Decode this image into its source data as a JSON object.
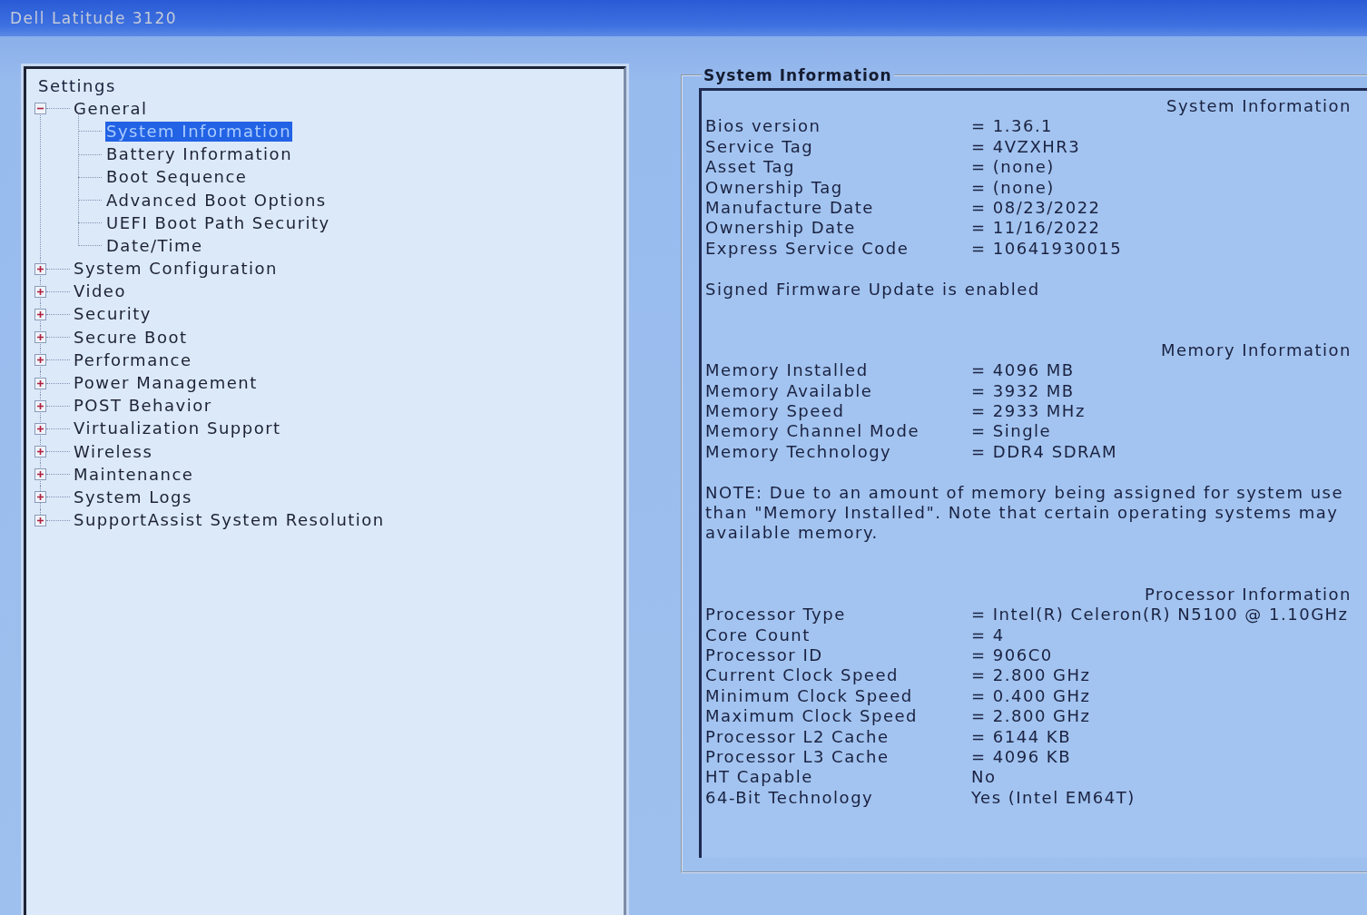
{
  "window": {
    "title": "Dell Latitude 3120"
  },
  "tree": {
    "title": "Settings",
    "items": [
      {
        "label": "General",
        "expanded": true,
        "selected": false,
        "children": [
          {
            "label": "System Information",
            "selected": true
          },
          {
            "label": "Battery Information",
            "selected": false
          },
          {
            "label": "Boot Sequence",
            "selected": false
          },
          {
            "label": "Advanced Boot Options",
            "selected": false
          },
          {
            "label": "UEFI Boot Path Security",
            "selected": false
          },
          {
            "label": "Date/Time",
            "selected": false
          }
        ]
      },
      {
        "label": "System Configuration",
        "expanded": false,
        "selected": false
      },
      {
        "label": "Video",
        "expanded": false,
        "selected": false
      },
      {
        "label": "Security",
        "expanded": false,
        "selected": false
      },
      {
        "label": "Secure Boot",
        "expanded": false,
        "selected": false
      },
      {
        "label": "Performance",
        "expanded": false,
        "selected": false
      },
      {
        "label": "Power Management",
        "expanded": false,
        "selected": false
      },
      {
        "label": "POST Behavior",
        "expanded": false,
        "selected": false
      },
      {
        "label": "Virtualization Support",
        "expanded": false,
        "selected": false
      },
      {
        "label": "Wireless",
        "expanded": false,
        "selected": false
      },
      {
        "label": "Maintenance",
        "expanded": false,
        "selected": false
      },
      {
        "label": "System Logs",
        "expanded": false,
        "selected": false
      },
      {
        "label": "SupportAssist System Resolution",
        "expanded": false,
        "selected": false
      }
    ]
  },
  "panel": {
    "title": "System Information",
    "sections": [
      {
        "heading": "System Information",
        "rows": [
          {
            "label": "Bios version",
            "value": "= 1.36.1"
          },
          {
            "label": "Service Tag",
            "value": "= 4VZXHR3"
          },
          {
            "label": "Asset Tag",
            "value": "= (none)"
          },
          {
            "label": "Ownership Tag",
            "value": "= (none)"
          },
          {
            "label": "Manufacture Date",
            "value": "= 08/23/2022"
          },
          {
            "label": "Ownership Date",
            "value": "= 11/16/2022"
          },
          {
            "label": "Express Service Code",
            "value": "= 10641930015"
          }
        ],
        "note_lines": [
          "Signed Firmware Update is enabled"
        ]
      },
      {
        "heading": "Memory Information",
        "rows": [
          {
            "label": "Memory Installed",
            "value": "= 4096 MB"
          },
          {
            "label": "Memory Available",
            "value": "= 3932 MB"
          },
          {
            "label": "Memory Speed",
            "value": "= 2933 MHz"
          },
          {
            "label": "Memory Channel Mode",
            "value": "= Single"
          },
          {
            "label": "Memory Technology",
            "value": "= DDR4 SDRAM"
          }
        ],
        "note_lines": [
          "NOTE: Due to an amount of memory being assigned for system use",
          "than \"Memory Installed\". Note that certain operating systems may",
          "available memory."
        ]
      },
      {
        "heading": "Processor Information",
        "rows": [
          {
            "label": "Processor Type",
            "value": "= Intel(R) Celeron(R) N5100 @ 1.10GHz"
          },
          {
            "label": "Core Count",
            "value": "= 4"
          },
          {
            "label": "Processor ID",
            "value": "= 906C0"
          },
          {
            "label": "Current Clock Speed",
            "value": "= 2.800 GHz"
          },
          {
            "label": "Minimum Clock Speed",
            "value": "= 0.400 GHz"
          },
          {
            "label": "Maximum Clock Speed",
            "value": "= 2.800 GHz"
          },
          {
            "label": "Processor L2 Cache",
            "value": "= 6144 KB"
          },
          {
            "label": "Processor L3 Cache",
            "value": "= 4096 KB"
          },
          {
            "label": "HT Capable",
            "value": "No"
          },
          {
            "label": "64-Bit Technology",
            "value": "Yes (Intel EM64T)"
          }
        ]
      }
    ]
  }
}
